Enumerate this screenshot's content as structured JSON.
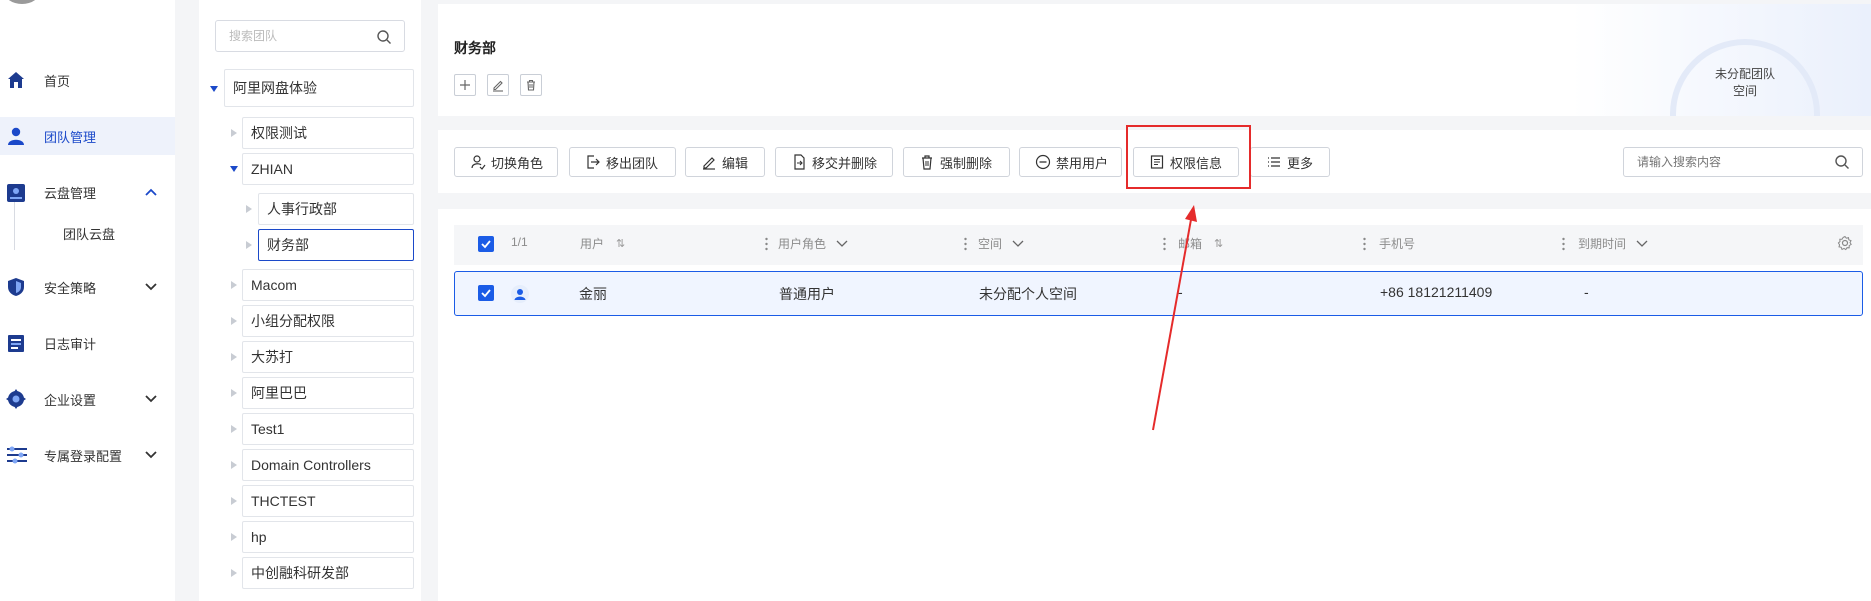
{
  "nav": {
    "items": [
      {
        "label": "首页",
        "icon": "home-icon"
      },
      {
        "label": "团队管理",
        "icon": "user-icon"
      },
      {
        "label": "云盘管理",
        "icon": "cloud-drive-icon"
      },
      {
        "label": "安全策略",
        "icon": "shield-icon"
      },
      {
        "label": "日志审计",
        "icon": "log-icon"
      },
      {
        "label": "企业设置",
        "icon": "settings-gear-icon"
      },
      {
        "label": "专属登录配置",
        "icon": "sliders-icon"
      }
    ],
    "sub_items": [
      {
        "label": "团队云盘"
      }
    ]
  },
  "tree": {
    "search_placeholder": "搜索团队",
    "root": "阿里网盘体验",
    "nodes": [
      {
        "label": "权限测试"
      },
      {
        "label": "ZHIAN"
      },
      {
        "label": "人事行政部"
      },
      {
        "label": "财务部"
      },
      {
        "label": "Macom"
      },
      {
        "label": "小组分配权限"
      },
      {
        "label": "大苏打"
      },
      {
        "label": "阿里巴巴"
      },
      {
        "label": "Test1"
      },
      {
        "label": "Domain Controllers"
      },
      {
        "label": "THCTEST"
      },
      {
        "label": "hp"
      },
      {
        "label": "中创融科研发部"
      }
    ]
  },
  "header": {
    "team_name": "财务部",
    "gauge_text_line1": "未分配团队",
    "gauge_text_line2": "空间"
  },
  "toolbar": {
    "buttons": [
      {
        "label": "切换角色"
      },
      {
        "label": "移出团队"
      },
      {
        "label": "编辑"
      },
      {
        "label": "移交并删除"
      },
      {
        "label": "强制删除"
      },
      {
        "label": "禁用用户"
      },
      {
        "label": "权限信息"
      },
      {
        "label": "更多"
      }
    ],
    "search_placeholder": "请输入搜索内容"
  },
  "table": {
    "selection_count": "1/1",
    "columns": [
      "用户",
      "用户角色",
      "空间",
      "邮箱",
      "手机号",
      "到期时间"
    ],
    "rows": [
      {
        "user": "金丽",
        "role": "普通用户",
        "space": "未分配个人空间",
        "email": "-",
        "phone": "+86 18121211409",
        "expiry": "-"
      }
    ]
  },
  "colors": {
    "accent": "#1b5ce6",
    "highlight_box": "#e52b2b",
    "annotation_arrow": "#e52b2b"
  }
}
